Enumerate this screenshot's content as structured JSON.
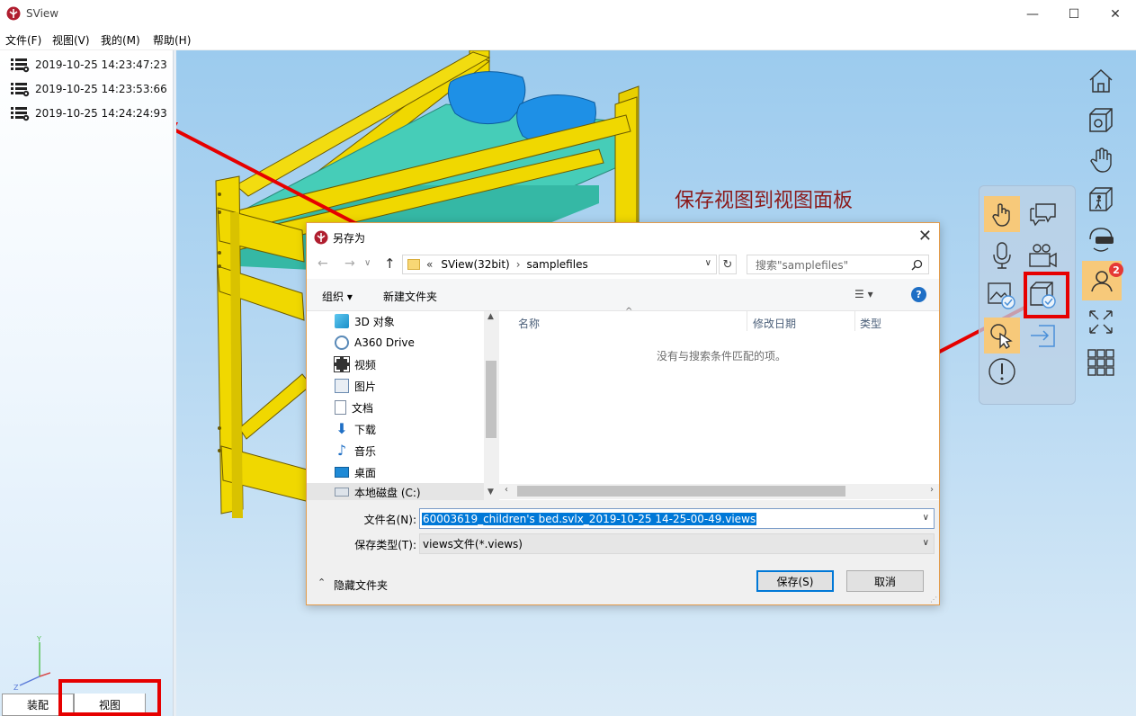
{
  "window": {
    "title": "SView",
    "minimize_glyph": "—",
    "maximize_glyph": "☐",
    "close_glyph": "✕"
  },
  "menu": [
    "文件(F)",
    "视图(V)",
    "我的(M)",
    "帮助(H)"
  ],
  "views_panel": {
    "entries": [
      "2019-10-25 14:23:47:23",
      "2019-10-25 14:23:53:66",
      "2019-10-25 14:24:24:93"
    ],
    "tabs": [
      "装配",
      "视图"
    ],
    "axis_labels": {
      "y": "Y",
      "z": "Z"
    }
  },
  "annotation": {
    "title": "保存视图到视图面板",
    "color": "#8b1a1a"
  },
  "right_toolbar": {
    "icons": [
      "home-icon",
      "view-settings-icon",
      "hand-icon",
      "walk-icon",
      "vr-icon",
      "users-icon",
      "fullscreen-icon",
      "grid-icon"
    ],
    "users_badge": "2"
  },
  "popup_panel": {
    "icons": [
      "touch-icon",
      "comment-icon",
      "microphone-icon",
      "video-camera-icon",
      "image-check-icon",
      "save-view-icon",
      "pointer-icon",
      "exit-arrow-icon",
      "info-icon"
    ]
  },
  "dialog": {
    "title": "另存为",
    "close_glyph": "✕",
    "address": {
      "prefix": "«",
      "path": [
        "SView(32bit)",
        "samplefiles"
      ]
    },
    "search_placeholder": "搜索\"samplefiles\"",
    "toolbar": {
      "organize": "组织 ▾",
      "new_folder": "新建文件夹",
      "help": "?"
    },
    "tree": [
      "3D 对象",
      "A360 Drive",
      "视频",
      "图片",
      "文档",
      "下载",
      "音乐",
      "桌面",
      "本地磁盘 (C:)"
    ],
    "columns": [
      "名称",
      "修改日期",
      "类型"
    ],
    "empty_message": "没有与搜索条件匹配的项。",
    "filename_label": "文件名(N):",
    "filename_value": "60003619_children's bed.svlx_2019-10-25 14-25-00-49.views",
    "filetype_label": "保存类型(T):",
    "filetype_value": "views文件(*.views)",
    "hide_folders": "隐藏文件夹",
    "save_button": "保存(S)",
    "cancel_button": "取消"
  },
  "colors": {
    "accent": "#0078d7",
    "highlight_red": "#e60000",
    "bed_frame": "#f0d800",
    "mattress": "#46cdb8",
    "pillow": "#1e90e6",
    "active_tile": "#f7c97a"
  }
}
